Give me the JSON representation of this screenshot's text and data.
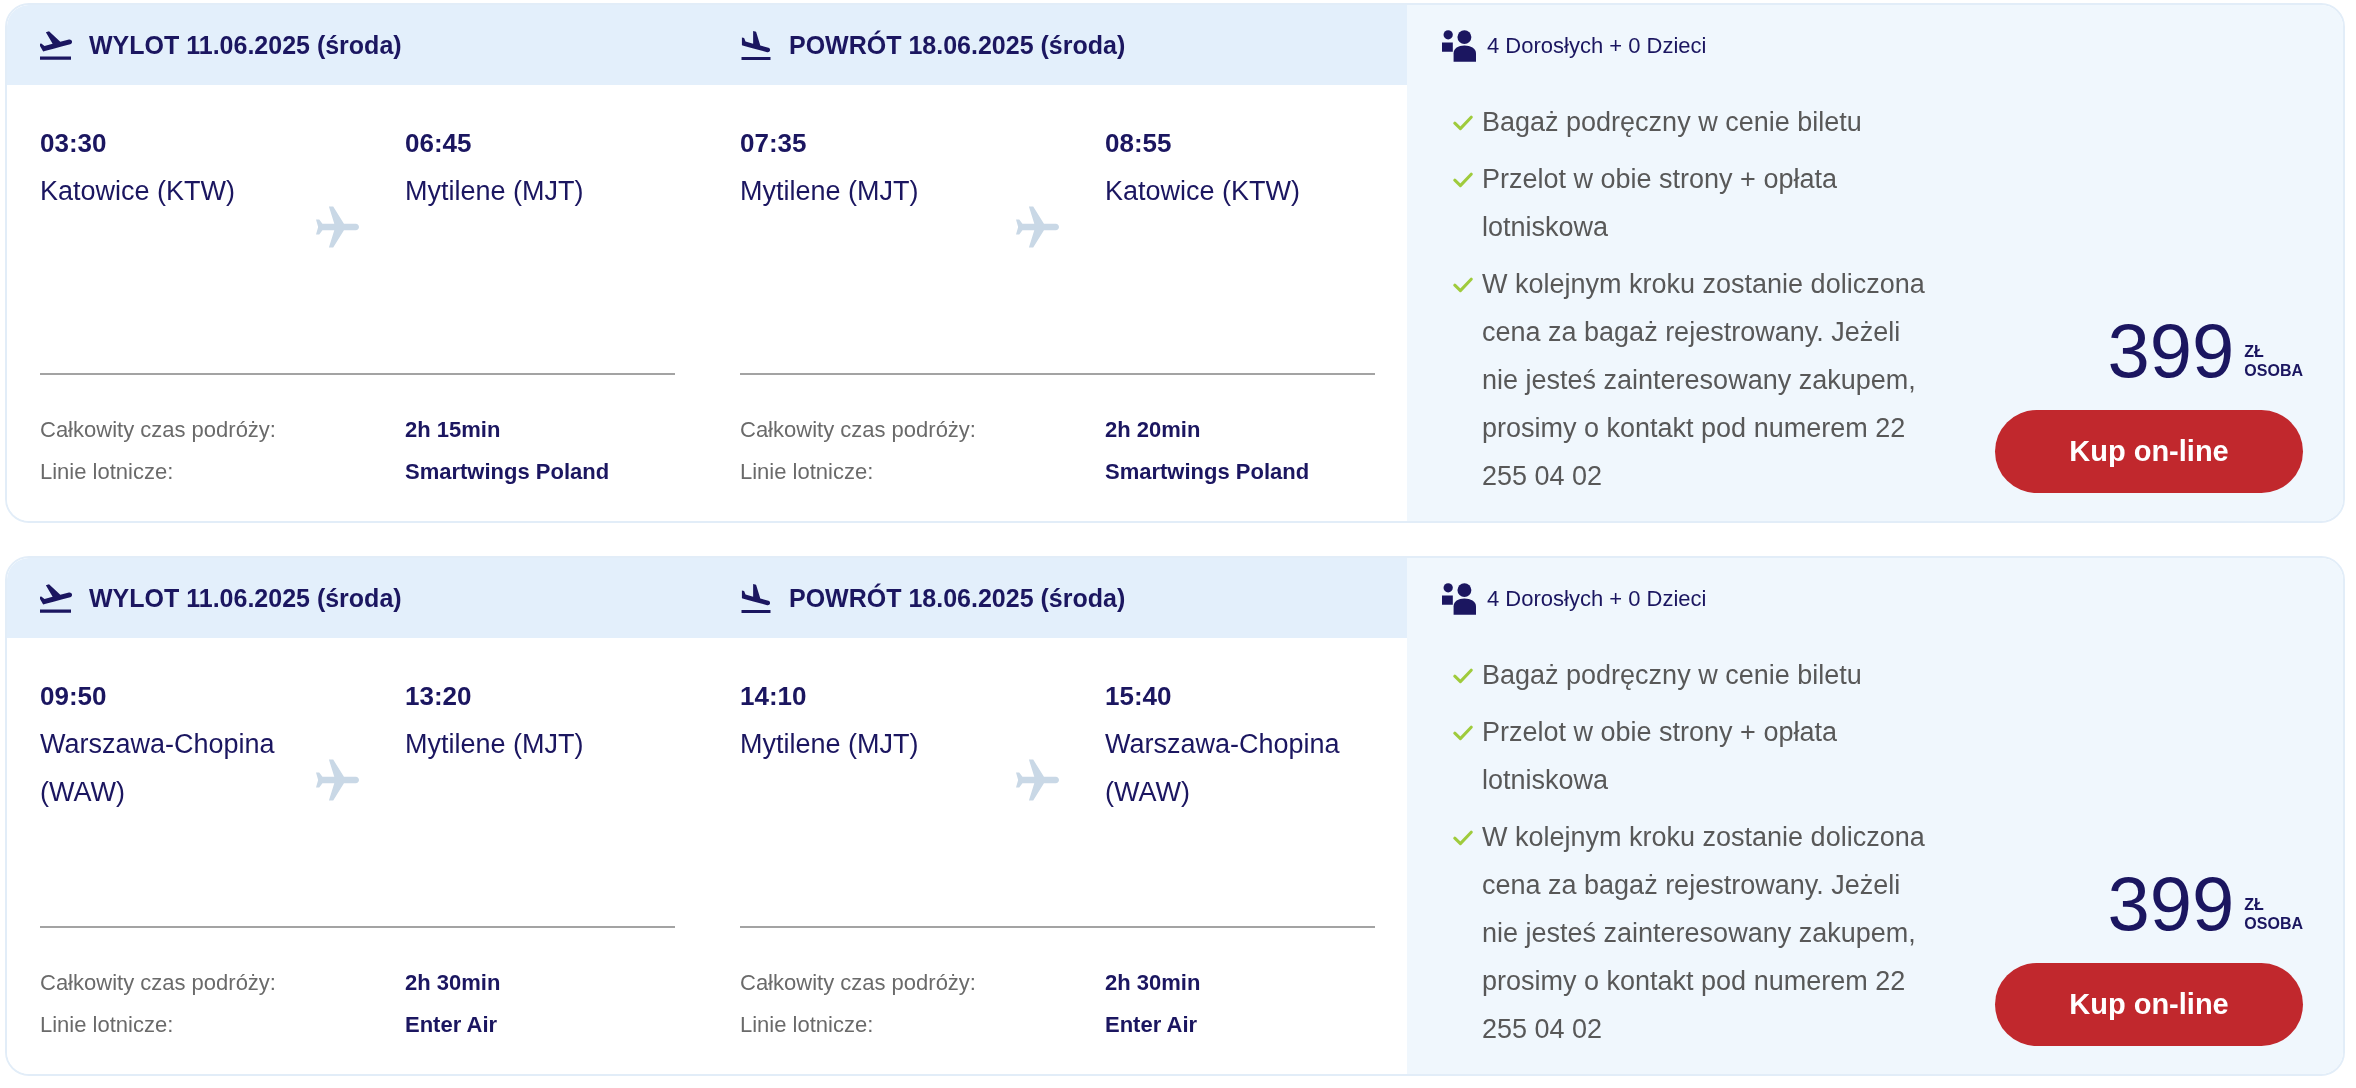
{
  "offers": [
    {
      "legs": [
        {
          "kind": "departure",
          "header": "WYLOT 11.06.2025 (środa)",
          "from": {
            "time": "03:30",
            "city": "Katowice (KTW)"
          },
          "to": {
            "time": "06:45",
            "city": "Mytilene (MJT)"
          },
          "details": [
            {
              "label": "Całkowity czas podróży:",
              "value": "2h 15min"
            },
            {
              "label": "Linie lotnicze:",
              "value": "Smartwings Poland"
            }
          ]
        },
        {
          "kind": "return",
          "header": "POWRÓT 18.06.2025 (środa)",
          "from": {
            "time": "07:35",
            "city": "Mytilene (MJT)"
          },
          "to": {
            "time": "08:55",
            "city": "Katowice (KTW)"
          },
          "details": [
            {
              "label": "Całkowity czas podróży:",
              "value": "2h 20min"
            },
            {
              "label": "Linie lotnicze:",
              "value": "Smartwings Poland"
            }
          ]
        }
      ],
      "passengers": "4 Dorosłych + 0 Dzieci",
      "features": [
        "Bagaż podręczny w cenie biletu",
        "Przelot w obie strony + opłata lotniskowa",
        "W kolejnym kroku zostanie doliczona cena za bagaż rejestrowany. Jeżeli nie jesteś zainteresowany zakupem, prosimy o kontakt pod numerem 22 255 04 02"
      ],
      "price": {
        "amount": "399",
        "currency": "ZŁ",
        "unit": "OSOBA"
      },
      "button": "Kup on-line"
    },
    {
      "legs": [
        {
          "kind": "departure",
          "header": "WYLOT 11.06.2025 (środa)",
          "from": {
            "time": "09:50",
            "city": "Warszawa-Chopina (WAW)"
          },
          "to": {
            "time": "13:20",
            "city": "Mytilene (MJT)"
          },
          "details": [
            {
              "label": "Całkowity czas podróży:",
              "value": "2h 30min"
            },
            {
              "label": "Linie lotnicze:",
              "value": "Enter Air"
            }
          ]
        },
        {
          "kind": "return",
          "header": "POWRÓT 18.06.2025 (środa)",
          "from": {
            "time": "14:10",
            "city": "Mytilene (MJT)"
          },
          "to": {
            "time": "15:40",
            "city": "Warszawa-Chopina (WAW)"
          },
          "details": [
            {
              "label": "Całkowity czas podróży:",
              "value": "2h 30min"
            },
            {
              "label": "Linie lotnicze:",
              "value": "Enter Air"
            }
          ]
        }
      ],
      "passengers": "4 Dorosłych + 0 Dzieci",
      "features": [
        "Bagaż podręczny w cenie biletu",
        "Przelot w obie strony + opłata lotniskowa",
        "W kolejnym kroku zostanie doliczona cena za bagaż rejestrowany. Jeżeli nie jesteś zainteresowany zakupem, prosimy o kontakt pod numerem 22 255 04 02"
      ],
      "price": {
        "amount": "399",
        "currency": "ZŁ",
        "unit": "OSOBA"
      },
      "button": "Kup on-line"
    }
  ]
}
